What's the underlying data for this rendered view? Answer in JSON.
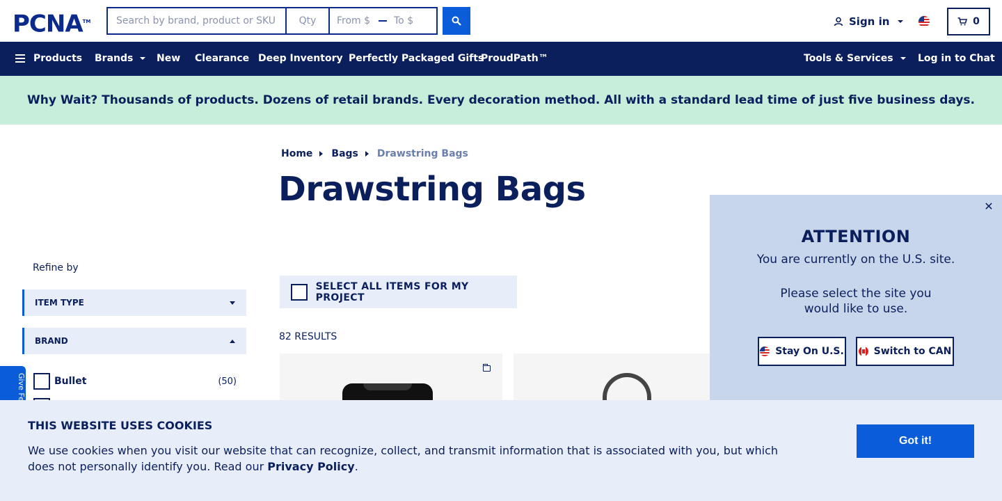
{
  "header": {
    "logo": "PCNA",
    "logo_tm": "TM",
    "search_placeholder": "Search by brand, product or SKU",
    "qty_placeholder": "Qty",
    "price_from_placeholder": "From $",
    "price_to_placeholder": "To $",
    "signin_label": "Sign in",
    "cart_count": "0"
  },
  "nav": {
    "products": "Products",
    "brands": "Brands",
    "new": "New",
    "clearance": "Clearance",
    "deep_inventory": "Deep Inventory",
    "gifts": "Perfectly Packaged Gifts",
    "proudpath": "ProudPath™",
    "tools": "Tools & Services",
    "chat": "Log in to Chat"
  },
  "banner": {
    "text": "Why Wait? Thousands of products. Dozens of retail brands. Every decoration method. All with a standard lead time of just five business days."
  },
  "breadcrumb": {
    "home": "Home",
    "bags": "Bags",
    "current": "Drawstring Bags"
  },
  "page_title": "Drawstring Bags",
  "sidebar": {
    "refine_label": "Refine by",
    "facets": [
      {
        "label": "ITEM TYPE",
        "expanded": false
      },
      {
        "label": "BRAND",
        "expanded": true
      }
    ],
    "brand_options": [
      {
        "label": "Bullet",
        "count": "(50)"
      }
    ],
    "feedback_label": "Give Fe"
  },
  "main": {
    "select_all_label": "SELECT ALL ITEMS FOR MY PROJECT",
    "results_label": "82 RESULTS"
  },
  "popup": {
    "title": "ATTENTION",
    "line1": "You are currently on the U.S. site.",
    "line2": "Please select the site you",
    "line3": "would like to use.",
    "stay_label": "Stay On U.S.",
    "switch_label": "Switch to CAN",
    "close_symbol": "✕"
  },
  "cookie": {
    "title": "THIS WEBSITE USES COOKIES",
    "text": "We use cookies when you visit our website that can recognize, collect, and transmit information that is associated with you, but which does not personally identify you. Read our ",
    "link_label": "Privacy Policy",
    "text_end": ".",
    "button_label": "Got it!"
  },
  "colors": {
    "navy": "#0a1f5c",
    "accent_blue": "#0a5cd8",
    "banner_green": "#c6eedb",
    "panel_blue": "#c8d6ec",
    "light_panel": "#e8eef9"
  }
}
